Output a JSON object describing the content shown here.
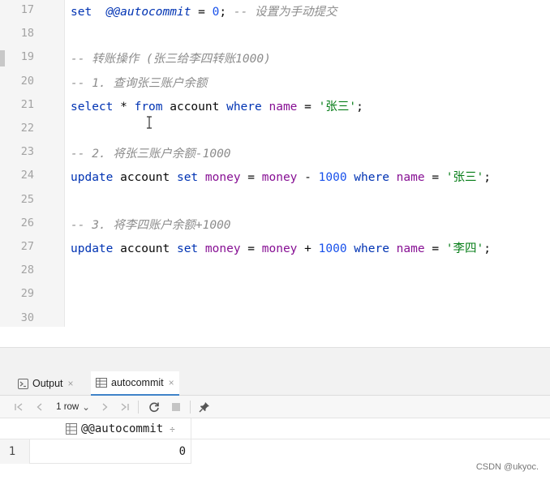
{
  "editor": {
    "lines": [
      {
        "num": "17",
        "tokens": [
          [
            "kw",
            "set"
          ],
          [
            "",
            "  "
          ],
          [
            "var",
            "@@autocommit"
          ],
          [
            "",
            " = "
          ],
          [
            "num",
            "0"
          ],
          [
            "",
            "; "
          ],
          [
            "cm",
            "-- 设置为手动提交"
          ]
        ]
      },
      {
        "num": "18",
        "tokens": []
      },
      {
        "num": "19",
        "tokens": [
          [
            "cm",
            "-- 转账操作 (张三给李四转账1000)"
          ]
        ]
      },
      {
        "num": "20",
        "tokens": [
          [
            "cm",
            "-- 1. 查询张三账户余额"
          ]
        ]
      },
      {
        "num": "21",
        "tokens": [
          [
            "kw",
            "select"
          ],
          [
            "",
            " * "
          ],
          [
            "kw",
            "from"
          ],
          [
            "",
            " account "
          ],
          [
            "kw",
            "where"
          ],
          [
            "",
            " "
          ],
          [
            "fn",
            "name"
          ],
          [
            "",
            " = "
          ],
          [
            "str",
            "'张三'"
          ],
          [
            "",
            ";"
          ]
        ]
      },
      {
        "num": "22",
        "tokens": []
      },
      {
        "num": "23",
        "tokens": [
          [
            "cm",
            "-- 2. 将张三账户余额-1000"
          ]
        ]
      },
      {
        "num": "24",
        "tokens": [
          [
            "kw",
            "update"
          ],
          [
            "",
            " account "
          ],
          [
            "kw",
            "set"
          ],
          [
            "",
            " "
          ],
          [
            "fn",
            "money"
          ],
          [
            "",
            " = "
          ],
          [
            "fn",
            "money"
          ],
          [
            "",
            " - "
          ],
          [
            "num",
            "1000"
          ],
          [
            "",
            " "
          ],
          [
            "kw",
            "where"
          ],
          [
            "",
            " "
          ],
          [
            "fn",
            "name"
          ],
          [
            "",
            " = "
          ],
          [
            "str",
            "'张三'"
          ],
          [
            "",
            ";"
          ]
        ]
      },
      {
        "num": "25",
        "tokens": []
      },
      {
        "num": "26",
        "tokens": [
          [
            "cm",
            "-- 3. 将李四账户余额+1000"
          ]
        ]
      },
      {
        "num": "27",
        "tokens": [
          [
            "kw",
            "update"
          ],
          [
            "",
            " account "
          ],
          [
            "kw",
            "set"
          ],
          [
            "",
            " "
          ],
          [
            "fn",
            "money"
          ],
          [
            "",
            " = "
          ],
          [
            "fn",
            "money"
          ],
          [
            "",
            " + "
          ],
          [
            "num",
            "1000"
          ],
          [
            "",
            " "
          ],
          [
            "kw",
            "where"
          ],
          [
            "",
            " "
          ],
          [
            "fn",
            "name"
          ],
          [
            "",
            " = "
          ],
          [
            "str",
            "'李四'"
          ],
          [
            "",
            ";"
          ]
        ]
      },
      {
        "num": "28",
        "tokens": []
      },
      {
        "num": "29",
        "tokens": []
      },
      {
        "num": "30",
        "tokens": []
      }
    ]
  },
  "tabs": {
    "output_label": "Output",
    "output_close": "×",
    "autocommit_label": "autocommit",
    "autocommit_close": "×"
  },
  "toolbar": {
    "first_icon": "|<",
    "prev_icon": "<",
    "rows_label": "1 row",
    "rows_dropdown": "⌄",
    "next_icon": ">",
    "last_icon": ">|",
    "refresh_icon": "refresh-icon",
    "stop_icon": "stop-icon",
    "pin_icon": "pin-icon"
  },
  "grid": {
    "column_header": "@@autocommit",
    "sort_glyph": "÷",
    "row_number": "1",
    "cell_value": "0"
  },
  "watermark": "CSDN @ukyoc.",
  "colors": {
    "keyword": "#0033b3",
    "string": "#067d17",
    "number": "#1750eb",
    "comment": "#8c8c8c",
    "function": "#871094",
    "tab_accent": "#4083c9"
  }
}
